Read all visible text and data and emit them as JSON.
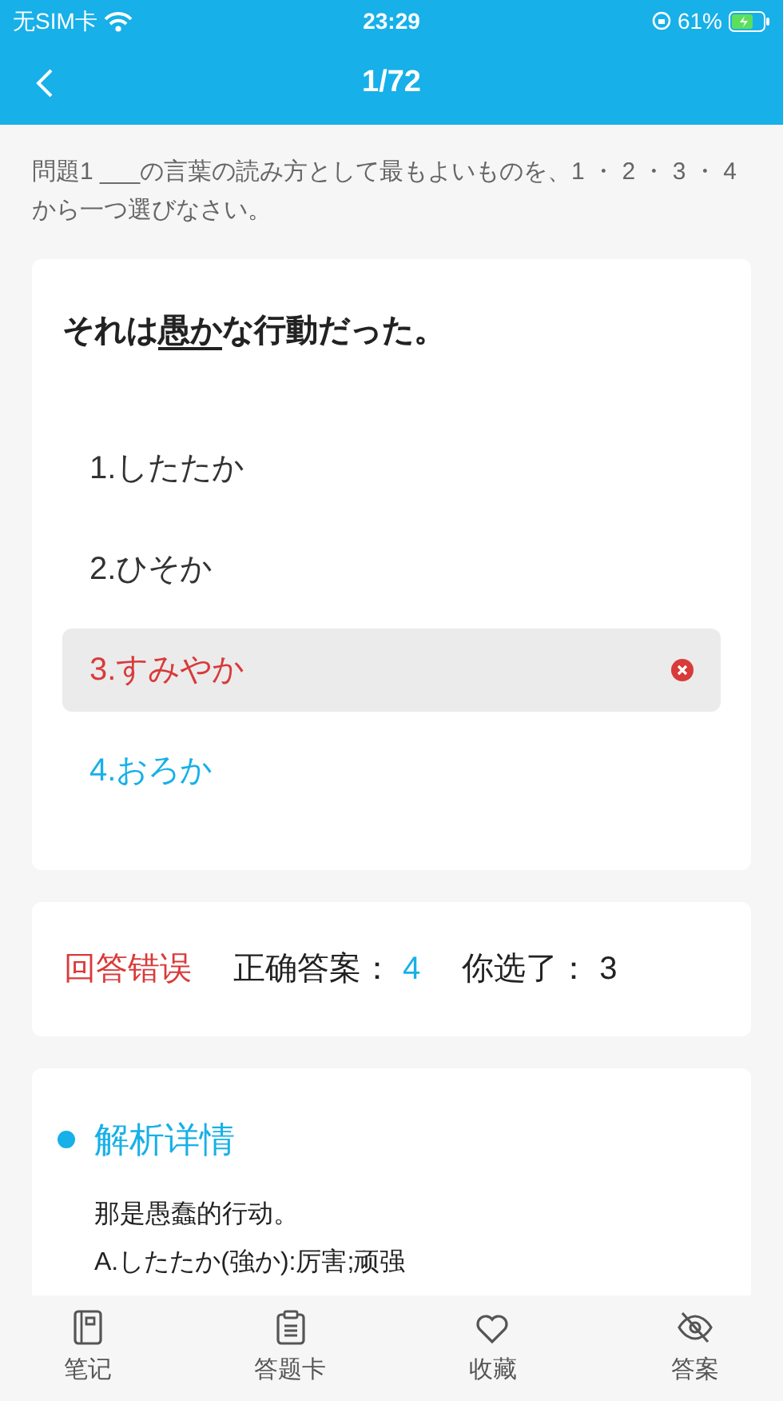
{
  "status_bar": {
    "carrier": "无SIM卡",
    "time": "23:29",
    "battery": "61%"
  },
  "nav": {
    "title": "1/72"
  },
  "instruction": "問題1 ___の言葉の読み方として最もよいものを、1 ・ 2 ・ 3 ・ 4 から一つ選びなさい。",
  "question": {
    "before": "それは",
    "underlined_word": "愚か",
    "after": "な行動だった。"
  },
  "options": [
    {
      "label": "1.したたか",
      "selected": false,
      "correct": false
    },
    {
      "label": "2.ひそか",
      "selected": false,
      "correct": false
    },
    {
      "label": "3.すみやか",
      "selected": true,
      "correct": false
    },
    {
      "label": "4.おろか",
      "selected": false,
      "correct": true
    }
  ],
  "result": {
    "verdict": "回答错误",
    "correct_label": "正确答案：",
    "correct_value": "4",
    "chosen_label": "你选了：",
    "chosen_value": "3"
  },
  "explanation": {
    "title": "解析详情",
    "lines": [
      "那是愚蠢的行动。",
      "A.したたか(強か):厉害;顽强"
    ]
  },
  "tab_bar": [
    {
      "kind": "notes",
      "label": "笔记"
    },
    {
      "kind": "card",
      "label": "答题卡"
    },
    {
      "kind": "favorite",
      "label": "收藏"
    },
    {
      "kind": "answer",
      "label": "答案"
    }
  ]
}
